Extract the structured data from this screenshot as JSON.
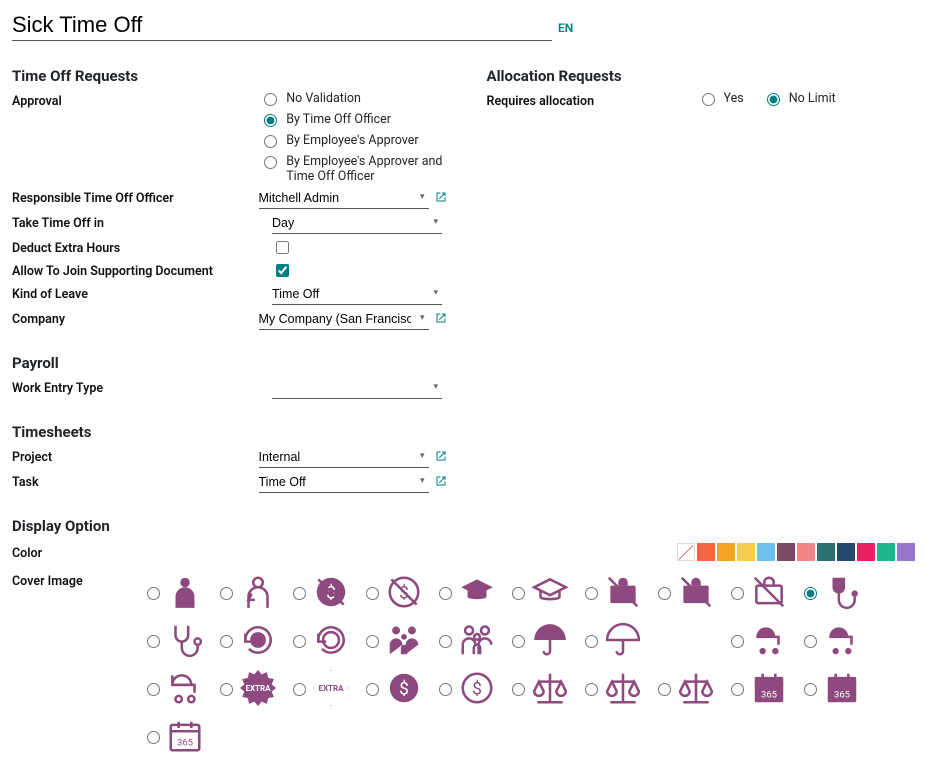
{
  "title": "Sick Time Off",
  "lang": "EN",
  "sectionTimeOffReq": "Time Off Requests",
  "sectionAlloc": "Allocation Requests",
  "sectionPayroll": "Payroll",
  "sectionTimesheets": "Timesheets",
  "sectionDisplay": "Display Option",
  "labels": {
    "approval": "Approval",
    "requiresAlloc": "Requires allocation",
    "respOfficer": "Responsible Time Off Officer",
    "takeIn": "Take Time Off in",
    "deduct": "Deduct Extra Hours",
    "allowDoc": "Allow To Join Supporting Document",
    "kind": "Kind of Leave",
    "company": "Company",
    "workEntry": "Work Entry Type",
    "project": "Project",
    "task": "Task",
    "color": "Color",
    "cover": "Cover Image"
  },
  "approvalOptions": [
    "No Validation",
    "By Time Off Officer",
    "By Employee's Approver",
    "By Employee's Approver and Time Off Officer"
  ],
  "approvalSelected": 1,
  "allocOptions": {
    "yes": "Yes",
    "noLimit": "No Limit"
  },
  "allocSelected": "noLimit",
  "values": {
    "officer": "Mitchell Admin",
    "takeIn": "Day",
    "deduct": false,
    "allowDoc": true,
    "kind": "Time Off",
    "company": "My Company (San Francisco)",
    "workEntry": "",
    "project": "Internal",
    "task": "Time Off"
  },
  "colors": [
    "none",
    "#f76642",
    "#f4a224",
    "#f7cd50",
    "#6cc2ed",
    "#7a4b63",
    "#f08686",
    "#2b7171",
    "#254a6e",
    "#e91e63",
    "#1fb58f",
    "#9575cd"
  ],
  "coverSelectedIndex": 9,
  "coverIcons": [
    "worker-fill",
    "worker-outline",
    "no-dollar-fill",
    "no-dollar-outline",
    "graduation-fill",
    "graduation-outline",
    "no-briefcase-fill",
    "no-briefcase-fill2",
    "no-briefcase-outline",
    "stethoscope-fill",
    "stethoscope-outline",
    "back-time-fill",
    "back-time-outline",
    "family-fill",
    "family-outline",
    "umbrella-fill",
    "umbrella-outline",
    "blank",
    "stroller-fill",
    "stroller-fill2",
    "stroller-outline",
    "extra-fill",
    "extra-outline",
    "coin-fill",
    "coin-outline",
    "scales-fill",
    "scales-outline",
    "scales-outline2",
    "calendar-fill",
    "calendar-fill2",
    "calendar-outline"
  ]
}
